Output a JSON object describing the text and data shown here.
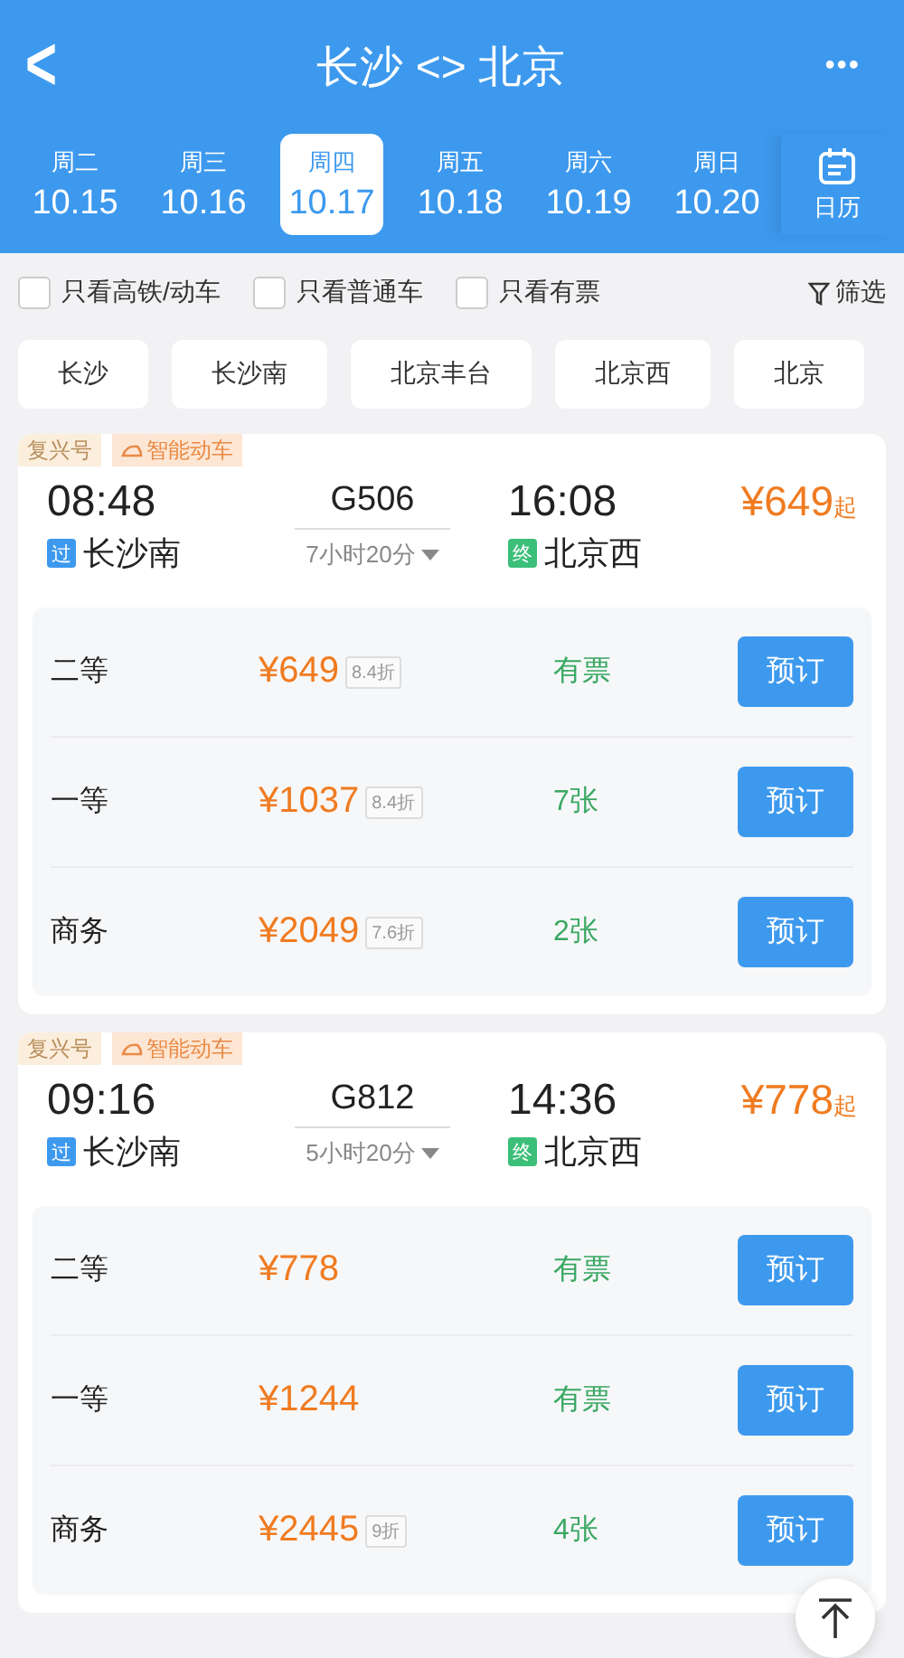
{
  "header": {
    "back": "<",
    "title": "长沙 <> 北京",
    "more": "•••"
  },
  "dates": [
    {
      "weekday": "周二",
      "date": "10.15",
      "selected": false
    },
    {
      "weekday": "周三",
      "date": "10.16",
      "selected": false
    },
    {
      "weekday": "周四",
      "date": "10.17",
      "selected": true
    },
    {
      "weekday": "周五",
      "date": "10.18",
      "selected": false
    },
    {
      "weekday": "周六",
      "date": "10.19",
      "selected": false
    },
    {
      "weekday": "周日",
      "date": "10.20",
      "selected": false
    }
  ],
  "calendar": {
    "label": "日历"
  },
  "filters": [
    {
      "label": "只看高铁/动车",
      "checked": false
    },
    {
      "label": "只看普通车",
      "checked": false
    },
    {
      "label": "只看有票",
      "checked": false
    }
  ],
  "filter_button": "筛选",
  "stations": [
    "长沙",
    "长沙南",
    "北京丰台",
    "北京西",
    "北京"
  ],
  "trains": [
    {
      "tags": [
        "复兴号",
        "智能动车"
      ],
      "depart": "08:48",
      "number": "G506",
      "duration": "7小时20分",
      "arrive": "16:08",
      "from_mark": "过",
      "from": "长沙南",
      "to_mark": "终",
      "to": "北京西",
      "price": "¥649",
      "price_suffix": "起",
      "seats": [
        {
          "class": "二等",
          "price": "¥649",
          "discount": "8.4折",
          "availability": "有票",
          "button": "预订"
        },
        {
          "class": "一等",
          "price": "¥1037",
          "discount": "8.4折",
          "availability": "7张",
          "button": "预订"
        },
        {
          "class": "商务",
          "price": "¥2049",
          "discount": "7.6折",
          "availability": "2张",
          "button": "预订"
        }
      ]
    },
    {
      "tags": [
        "复兴号",
        "智能动车"
      ],
      "depart": "09:16",
      "number": "G812",
      "duration": "5小时20分",
      "arrive": "14:36",
      "from_mark": "过",
      "from": "长沙南",
      "to_mark": "终",
      "to": "北京西",
      "price": "¥778",
      "price_suffix": "起",
      "seats": [
        {
          "class": "二等",
          "price": "¥778",
          "availability": "有票",
          "button": "预订"
        },
        {
          "class": "一等",
          "price": "¥1244",
          "availability": "有票",
          "button": "预订"
        },
        {
          "class": "商务",
          "price": "¥2445",
          "discount": "9折",
          "availability": "4张",
          "button": "预订"
        }
      ]
    }
  ]
}
